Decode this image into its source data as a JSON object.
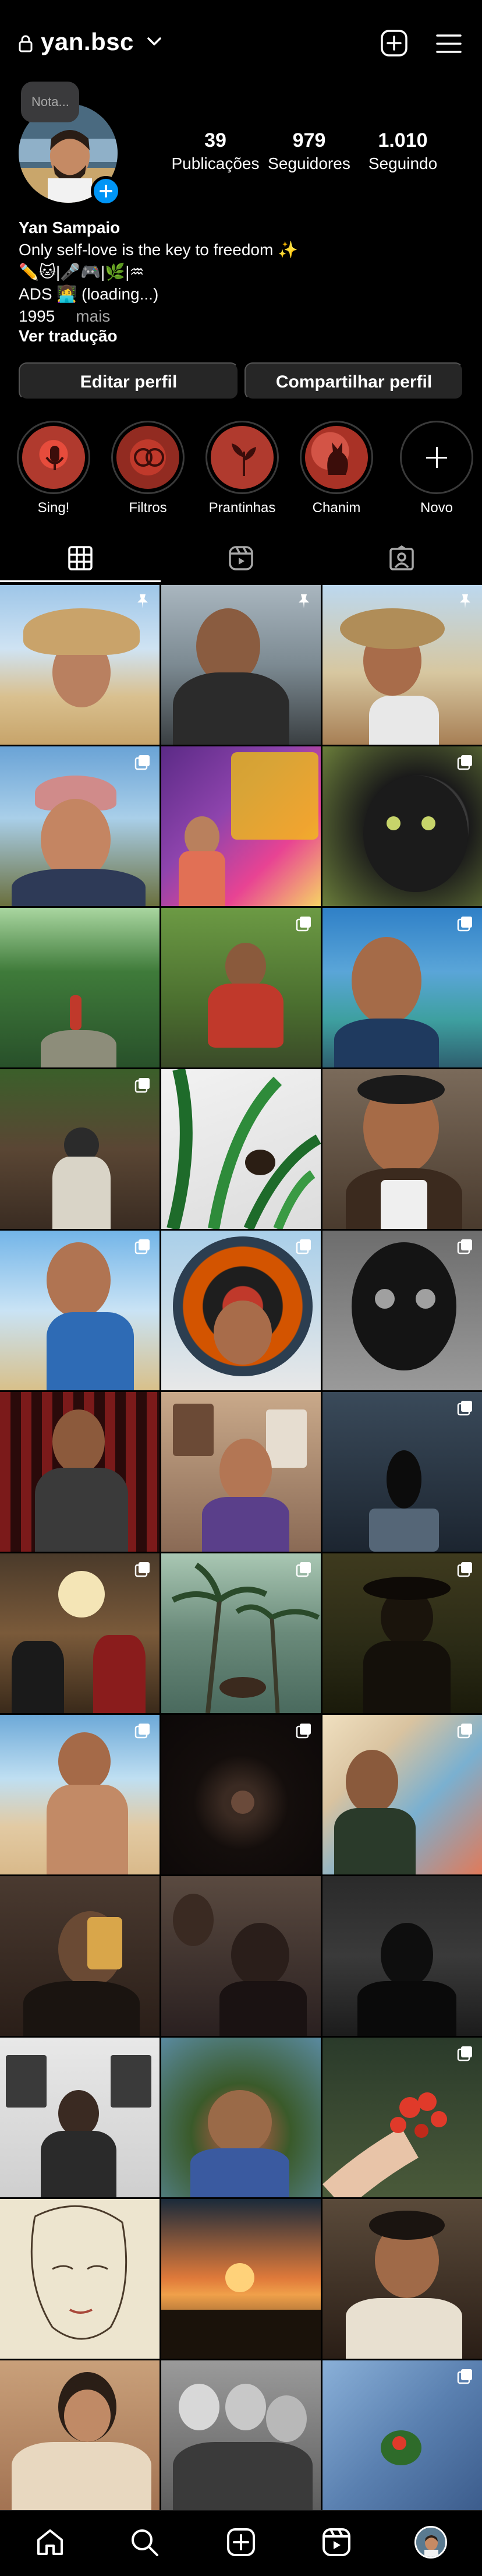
{
  "header": {
    "username": "yan.bsc"
  },
  "profile": {
    "note": "Nota...",
    "stats": [
      {
        "num": "39",
        "label": "Publicações"
      },
      {
        "num": "979",
        "label": "Seguidores"
      },
      {
        "num": "1.010",
        "label": "Seguindo"
      }
    ],
    "name": "Yan Sampaio",
    "bio_line1": "Only self-love is the key to freedom ✨",
    "bio_line2": "✏️🐱|🎤🎮|🌿|♒",
    "bio_line3": "ADS 👩‍💻 (loading...)",
    "bio_line4": "1995",
    "bio_more": "mais",
    "translate": "Ver tradução"
  },
  "buttons": {
    "edit": "Editar perfil",
    "share": "Compartilhar perfil"
  },
  "highlights": [
    {
      "label": "Sing!",
      "color": "#c0392b"
    },
    {
      "label": "Filtros",
      "color": "#b03a2e"
    },
    {
      "label": "Prantinhas",
      "color": "#a93226"
    },
    {
      "label": "Chanim",
      "color": "#922b21"
    },
    {
      "label": "Novo",
      "color": "#000000"
    }
  ],
  "colors": {
    "accent": "#0095f6",
    "button_bg": "#262626",
    "secondary_text": "#a8a8a8"
  }
}
